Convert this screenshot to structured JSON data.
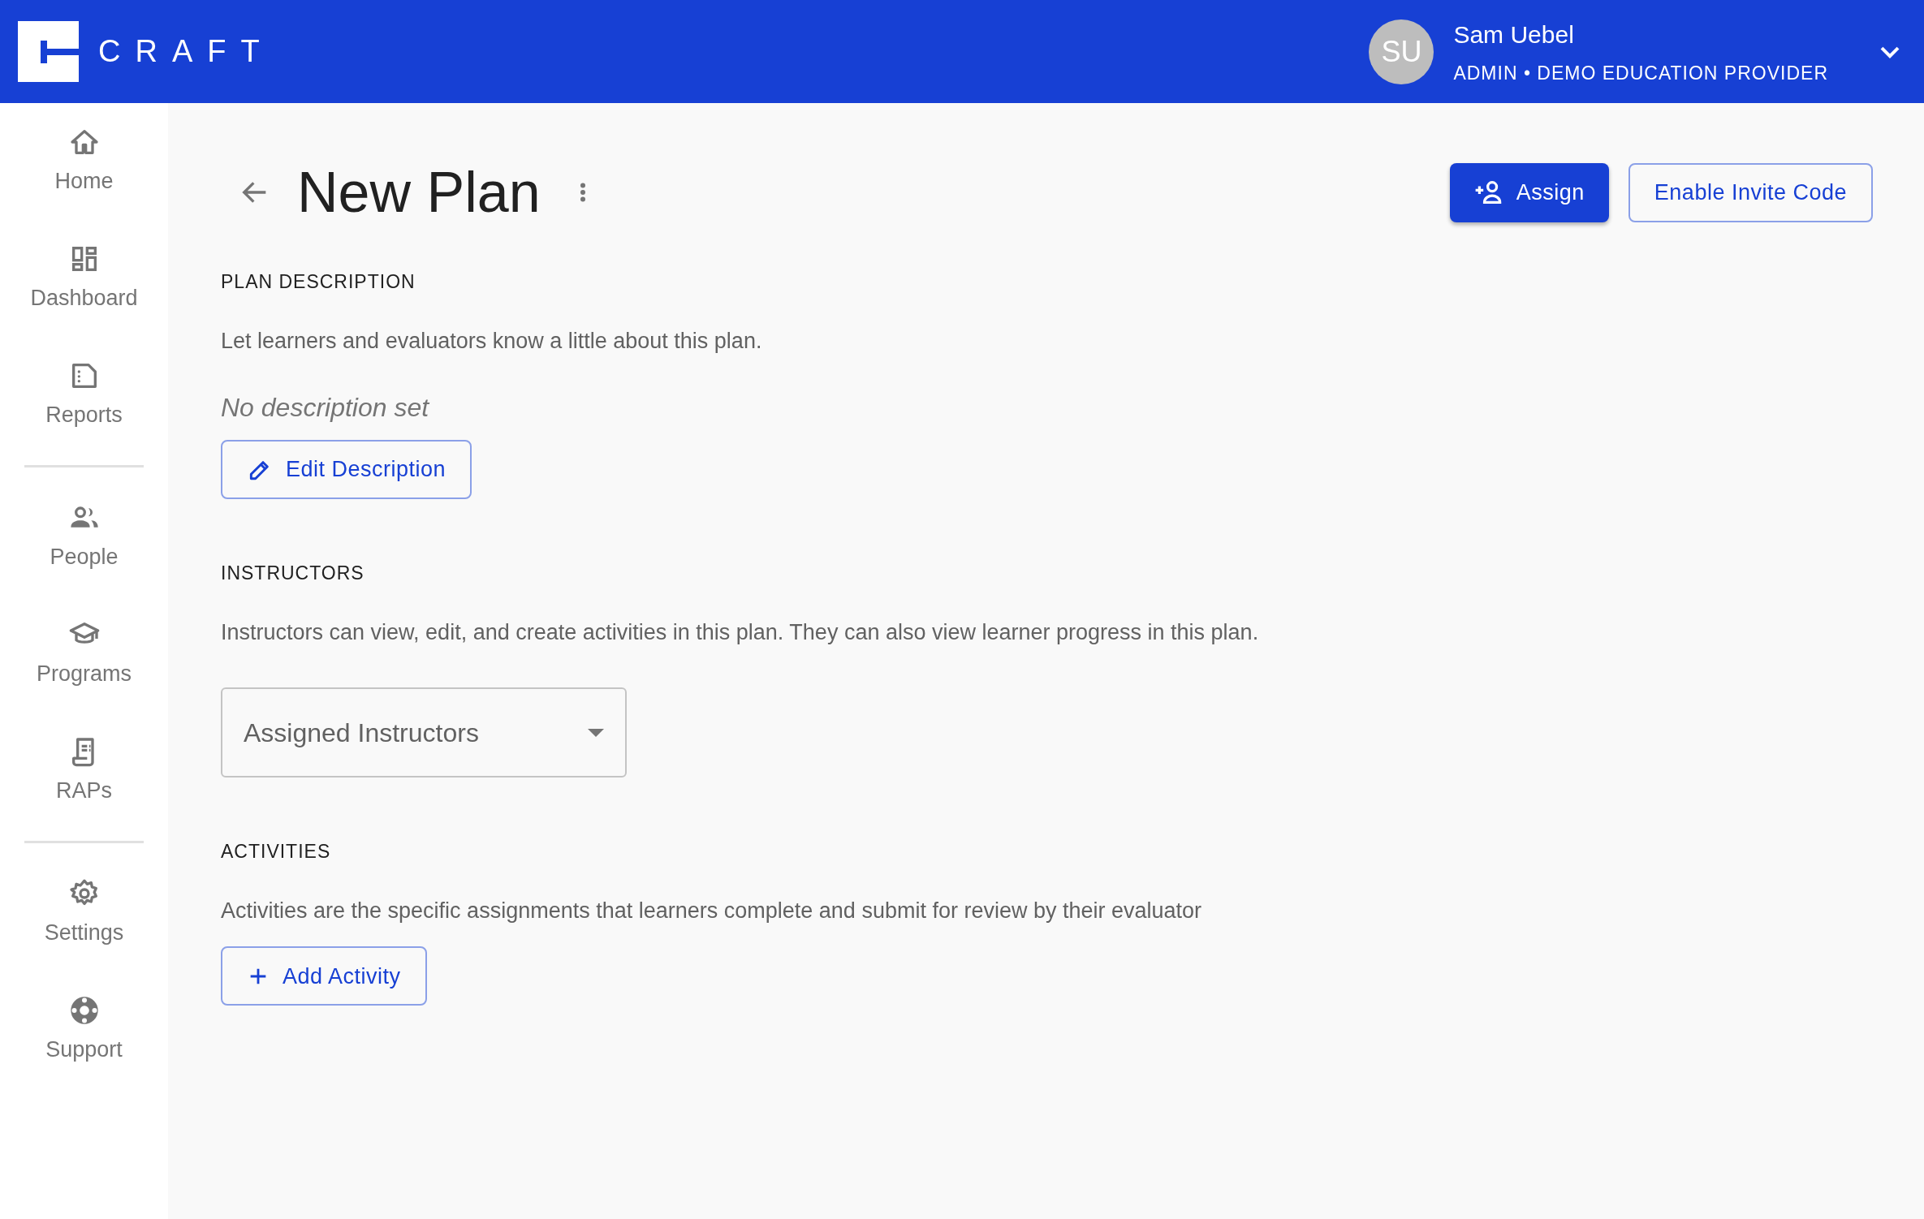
{
  "header": {
    "logo": "CRAFT",
    "user": {
      "initials": "SU",
      "name": "Sam Uebel",
      "role": "ADMIN • DEMO EDUCATION PROVIDER"
    }
  },
  "sidebar": {
    "groups": [
      [
        {
          "label": "Home"
        },
        {
          "label": "Dashboard"
        },
        {
          "label": "Reports"
        }
      ],
      [
        {
          "label": "People"
        },
        {
          "label": "Programs"
        },
        {
          "label": "RAPs"
        }
      ],
      [
        {
          "label": "Settings"
        },
        {
          "label": "Support"
        }
      ]
    ]
  },
  "page": {
    "title": "New Plan",
    "actions": [
      {
        "label": "Assign",
        "kind": "primary"
      },
      {
        "label": "Enable Invite Code",
        "kind": "outline"
      }
    ]
  },
  "sections": [
    {
      "heading": "PLAN DESCRIPTION",
      "text": "Let learners and evaluators know a little about this plan.",
      "kind": "description",
      "empty_note": "No description set",
      "button": "Edit Description"
    },
    {
      "heading": "INSTRUCTORS",
      "text": "Instructors can view, edit, and create activities in this plan. They can also view learner progress in this plan.",
      "kind": "select",
      "select": {
        "placeholder": "Assigned Instructors"
      }
    },
    {
      "heading": "ACTIVITIES",
      "text": "Activities are the specific assignments that learners complete and submit for review by their evaluator",
      "kind": "add",
      "button": "Add Activity"
    }
  ]
}
